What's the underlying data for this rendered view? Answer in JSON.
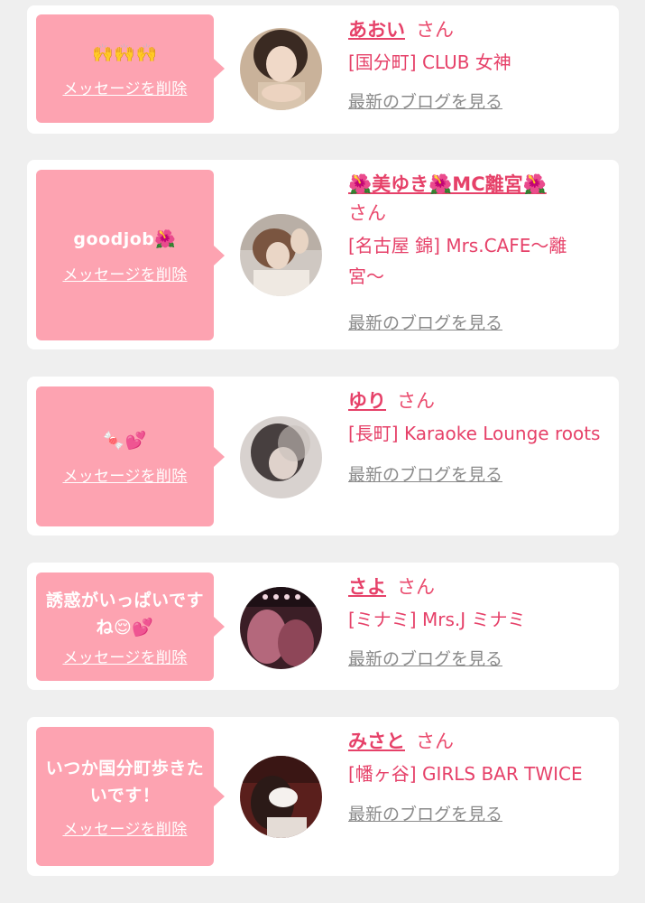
{
  "messages": [
    {
      "message": "🙌🙌🙌",
      "delete_label": "メッセージを削除",
      "name": "あおい",
      "honorific": "さん",
      "shop": "[国分町] CLUB 女神",
      "blog_link": "最新のブログを見る"
    },
    {
      "message": "goodjob🌺",
      "delete_label": "メッセージを削除",
      "name": "🌺美ゆき🌺MC離宮🌺",
      "honorific": "さん",
      "shop": "[名古屋 錦] Mrs.CAFE〜離宮〜",
      "blog_link": "最新のブログを見る"
    },
    {
      "message": "🍬💕",
      "delete_label": "メッセージを削除",
      "name": "ゆり",
      "honorific": "さん",
      "shop": "[長町] Karaoke Lounge roots",
      "blog_link": "最新のブログを見る"
    },
    {
      "message": "誘惑がいっぱいですね😌💕",
      "delete_label": "メッセージを削除",
      "name": "さよ",
      "honorific": "さん",
      "shop": "[ミナミ] Mrs.J ミナミ",
      "blog_link": "最新のブログを見る"
    },
    {
      "message": "いつか国分町歩きたいです！",
      "delete_label": "メッセージを削除",
      "name": "みさと",
      "honorific": "さん",
      "shop": "[幡ヶ谷] GIRLS BAR TWICE",
      "blog_link": "最新のブログを見る"
    }
  ],
  "colors": {
    "background": "#efefef",
    "bubble": "#fda3b1",
    "accent": "#e64169",
    "link_gray": "#8a8a8a"
  }
}
